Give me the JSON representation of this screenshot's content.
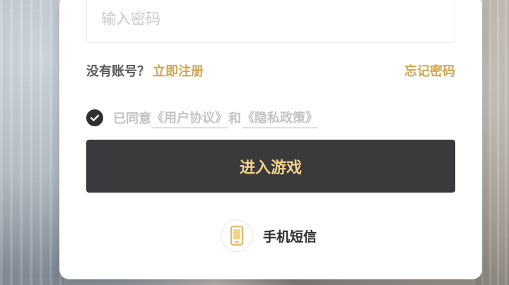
{
  "login": {
    "password_placeholder": "输入密码",
    "no_account": "没有账号？",
    "register": "立即注册",
    "forgot_password": "忘记密码",
    "agree_prefix": "已同意",
    "user_agreement": "《用户协议》",
    "and": "和",
    "privacy_policy": "《隐私政策》",
    "enter_button": "进入游戏",
    "sms_login": "手机短信"
  },
  "colors": {
    "accent_gold": "#d2a44d",
    "button_dark": "#3a393b",
    "button_text": "#f2d38a",
    "check_dark": "#2f2f2f"
  },
  "icons": {
    "agree": "checkmark-icon",
    "sms": "phone-icon"
  }
}
